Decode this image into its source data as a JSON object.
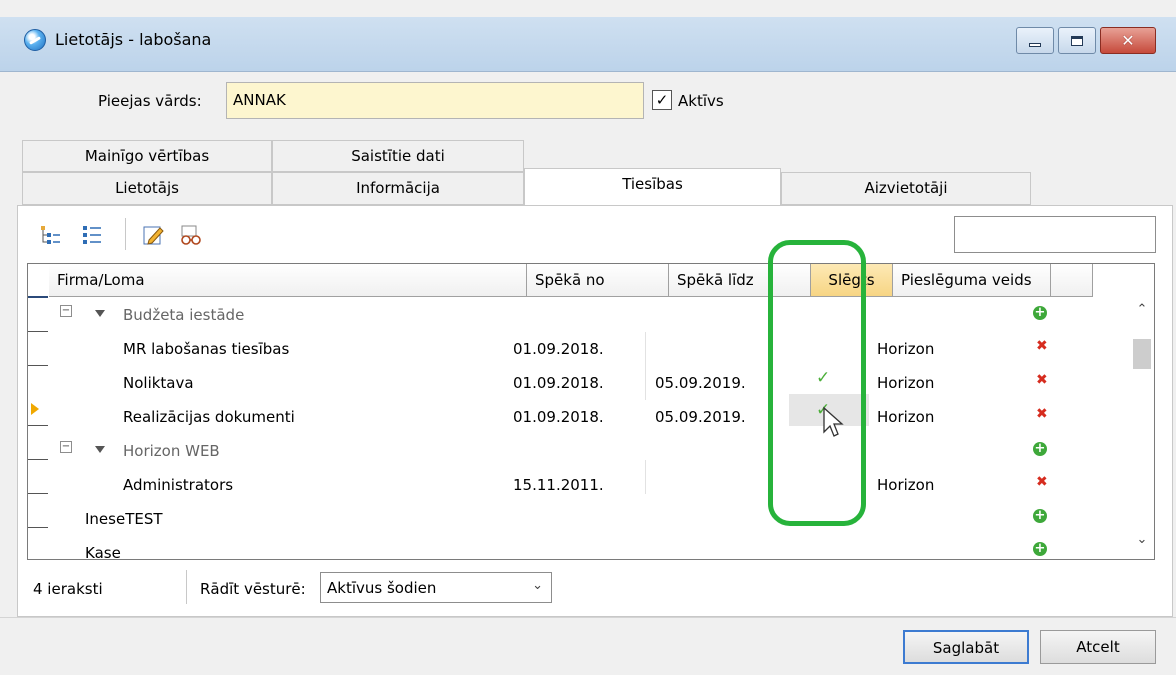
{
  "window": {
    "title": "Lietotājs - labošana"
  },
  "login": {
    "label": "Pieejas vārds:",
    "value": "ANNAK",
    "active_label": "Aktīvs",
    "active_checked": "✓"
  },
  "tabs": {
    "row1": [
      "Mainīgo vērtības",
      "Saistītie dati"
    ],
    "row2": [
      "Lietotājs",
      "Informācija",
      "Tiesības",
      "Aizvietotāji"
    ],
    "active": "Tiesības"
  },
  "grid": {
    "columns": [
      "Firma/Loma",
      "Spēkā no",
      "Spēkā līdz",
      "Slēgts",
      "Pieslēguma veids"
    ],
    "sorted_column": "Slēgts",
    "rows": [
      {
        "type": "group",
        "name": "Budžeta iestāde",
        "from": "",
        "to": "",
        "closed": "",
        "conn": "",
        "action": "add"
      },
      {
        "type": "item",
        "name": "MR labošanas tiesības",
        "from": "01.09.2018.",
        "to": "",
        "closed": "",
        "conn": "Horizon",
        "action": "delete"
      },
      {
        "type": "item",
        "name": "Noliktava",
        "from": "01.09.2018.",
        "to": "05.09.2019.",
        "closed": "✓",
        "conn": "Horizon",
        "action": "delete"
      },
      {
        "type": "item",
        "name": "Realizācijas dokumenti",
        "from": "01.09.2018.",
        "to": "05.09.2019.",
        "closed": "✓",
        "conn": "Horizon",
        "action": "delete"
      },
      {
        "type": "group",
        "name": "Horizon WEB",
        "from": "",
        "to": "",
        "closed": "",
        "conn": "",
        "action": "add"
      },
      {
        "type": "item",
        "name": "Administrators",
        "from": "15.11.2011.",
        "to": "",
        "closed": "",
        "conn": "Horizon",
        "action": "delete"
      },
      {
        "type": "top",
        "name": "IneseTEST",
        "from": "",
        "to": "",
        "closed": "",
        "conn": "",
        "action": "add"
      },
      {
        "type": "top",
        "name": "Kase",
        "from": "",
        "to": "",
        "closed": "",
        "conn": "",
        "action": "add"
      }
    ]
  },
  "status": {
    "count": "4 ieraksti",
    "history_label": "Rādīt vēsturē:",
    "history_value": "Aktīvus šodien"
  },
  "buttons": {
    "save": "Saglabāt",
    "cancel": "Atcelt"
  },
  "colors": {
    "highlight": "#27b33b",
    "input_bg": "#fdf6cf",
    "sorted_header": "#f7d584"
  },
  "icons": {
    "toolbar": [
      "tree-expand-icon",
      "list-view-icon",
      "edit-icon",
      "view-icon"
    ]
  }
}
